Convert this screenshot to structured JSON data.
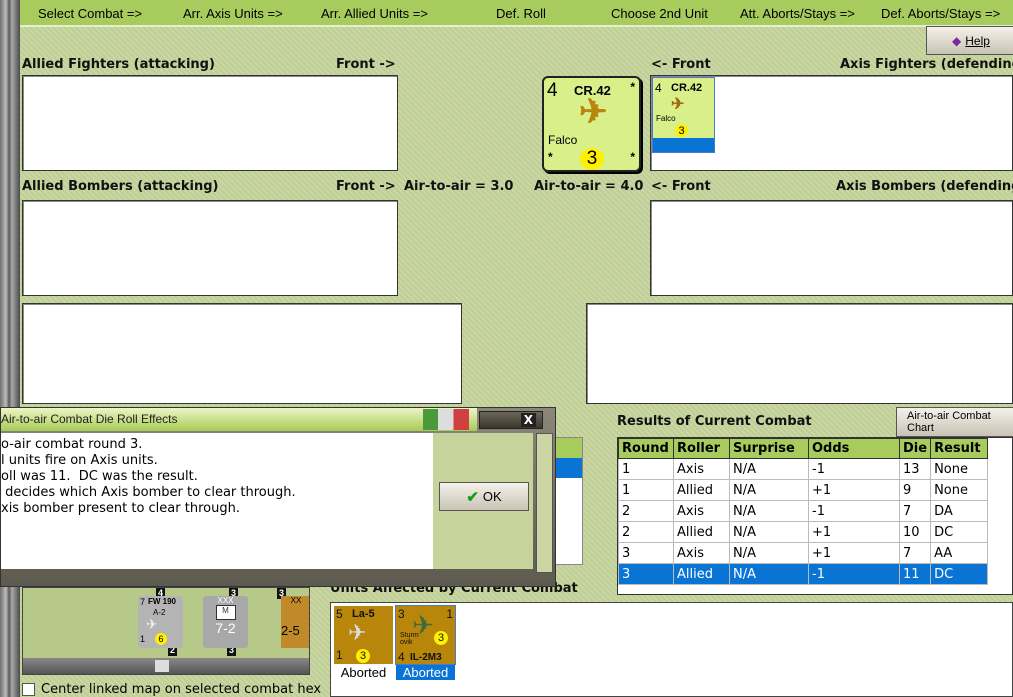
{
  "phases": [
    "Select Combat =>",
    "Arr. Axis Units =>",
    "Arr. Allied Units =>",
    "Def. Roll",
    "Choose 2nd Unit",
    "Att. Aborts/Stays =>",
    "Def. Aborts/Stays =>"
  ],
  "help_label": "Help",
  "labels": {
    "allied_fighters": "Allied Fighters (attacking)",
    "front_right": "Front ->",
    "front_left": "<- Front",
    "axis_fighters": "Axis Fighters (defending",
    "allied_bombers": "Allied Bombers (attacking)",
    "axis_bombers": "Axis Bombers (defending",
    "allied_a2a": "Air-to-air = 3.0",
    "axis_a2a": "Air-to-air = 4.0"
  },
  "selected_counter": {
    "strength": "4",
    "name": "CR.42",
    "nickname": "Falco",
    "range": "3",
    "star": "*"
  },
  "axis_fighter_counter": {
    "strength": "4",
    "name": "CR.42",
    "nickname": "Falco",
    "range": "3",
    "star": "*"
  },
  "dialog": {
    "title": "Air-to-air Combat Die Roll Effects",
    "lines": [
      "o-air combat round 3.",
      "l units fire on Axis units.",
      "oll was 11.  DC was the result.",
      " decides which Axis bomber to clear through.",
      "xis bomber present to clear through."
    ],
    "ok_label": "OK",
    "close_label": "X"
  },
  "results": {
    "title": "Results of Current Combat",
    "chart_button": "Air-to-air Combat Chart",
    "columns": [
      "Round",
      "Roller",
      "Surprise",
      "Odds",
      "Die",
      "Result"
    ],
    "rows": [
      [
        "1",
        "Axis",
        "N/A",
        "-1",
        "13",
        "None"
      ],
      [
        "1",
        "Allied",
        "N/A",
        "+1",
        "9",
        "None"
      ],
      [
        "2",
        "Axis",
        "N/A",
        "-1",
        "7",
        "DA"
      ],
      [
        "2",
        "Allied",
        "N/A",
        "+1",
        "10",
        "DC"
      ],
      [
        "3",
        "Axis",
        "N/A",
        "+1",
        "7",
        "AA"
      ],
      [
        "3",
        "Allied",
        "N/A",
        "-1",
        "11",
        "DC"
      ]
    ],
    "selected_row": 5
  },
  "map": {
    "counters": [
      {
        "top": "7",
        "name": "FW 190",
        "sub": "A-2",
        "bottom": "1",
        "range": "6"
      },
      {
        "top": "XXX",
        "name": "M",
        "sub": "7-2"
      },
      {
        "top": "XX",
        "sub": "2-5"
      }
    ],
    "hex_numbers": [
      "4",
      "3",
      "3",
      "2",
      "3"
    ]
  },
  "units_affected": {
    "title": "Units Affected by Current Combat",
    "units": [
      {
        "strength": "5",
        "name": "La-5",
        "bottom": "1",
        "range": "3",
        "status": "Aborted",
        "selected": false
      },
      {
        "strength": "3",
        "name": "IL-2M3",
        "sub": "Sturm ovik",
        "bottom": "4",
        "range": "3",
        "right": "1",
        "status": "Aborted",
        "selected": true
      }
    ]
  },
  "center_map_label": "Center linked map on selected combat hex",
  "center_map_checked": false,
  "colors": {
    "accent": "#a8cb5d",
    "selection": "#0a74d4",
    "background": "#c6d49c"
  }
}
